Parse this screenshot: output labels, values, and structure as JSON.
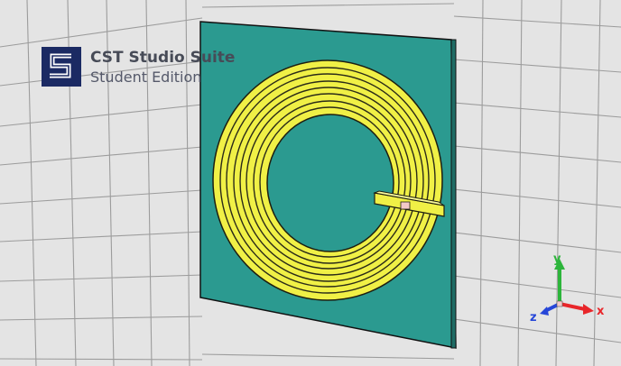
{
  "app": {
    "logo": {
      "name": "cst-logo-icon",
      "text": "S"
    },
    "title": "CST Studio Suite",
    "subtitle": "Student Edition"
  },
  "scene": {
    "background": "#e4e4e4",
    "grid_color": "#9c9c9c",
    "substrate_color": "#2b9a90",
    "coil_color": "#f0f046",
    "coil_outline_color": "#1e1e10"
  },
  "axes": {
    "x": {
      "label": "x",
      "color": "#e8262a"
    },
    "y": {
      "label": "y",
      "color": "#2db53b"
    },
    "z": {
      "label": "z",
      "color": "#2646d8"
    }
  }
}
